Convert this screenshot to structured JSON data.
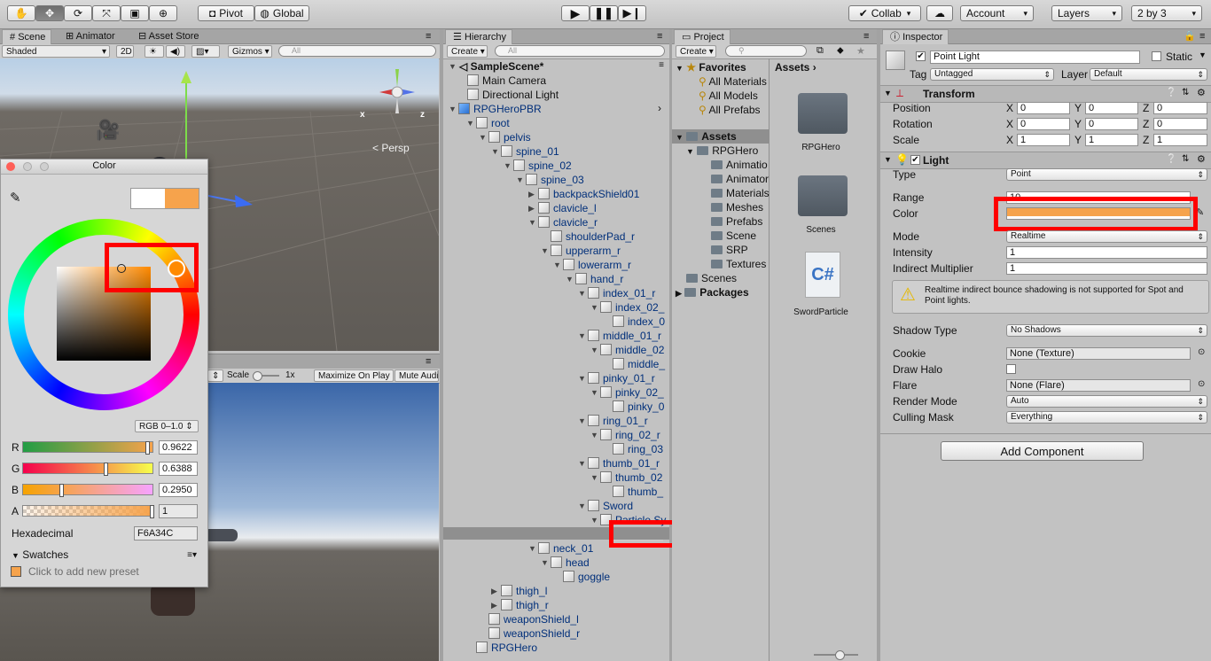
{
  "toolbar": {
    "tools": [
      "hand-tool",
      "move-tool",
      "rotate-tool",
      "scale-tool",
      "rect-tool",
      "transform-tool"
    ],
    "pivot": "Pivot",
    "global": "Global",
    "collab": "Collab",
    "account": "Account",
    "layers": "Layers",
    "layout": "2 by 3"
  },
  "scene": {
    "tabs": [
      "Scene",
      "Animator",
      "Asset Store"
    ],
    "shading": "Shaded",
    "mode2d": "2D",
    "gizmos": "Gizmos",
    "search_placeholder": "All",
    "persp": "Persp",
    "axis_x": "x",
    "axis_z": "z"
  },
  "game": {
    "scale_label": "Scale",
    "scale_value": "1x",
    "maximize": "Maximize On Play",
    "mute": "Mute Audi"
  },
  "color_picker": {
    "title": "Color",
    "mode": "RGB 0–1.0",
    "channels": [
      {
        "name": "R",
        "value": "0.9622",
        "level": 0.9622
      },
      {
        "name": "G",
        "value": "0.6388",
        "level": 0.6388
      },
      {
        "name": "B",
        "value": "0.2950",
        "level": 0.295
      },
      {
        "name": "A",
        "value": "1",
        "level": 1
      }
    ],
    "hex_label": "Hexadecimal",
    "hex_value": "F6A34C",
    "swatches_label": "Swatches",
    "swatch_hint": "Click to add new preset",
    "current_color": "#F6A34C",
    "previous_color": "#ffffff"
  },
  "hierarchy": {
    "title": "Hierarchy",
    "create": "Create",
    "search_placeholder": "All",
    "scene_name": "SampleScene*",
    "items": [
      {
        "label": "Main Camera"
      },
      {
        "label": "Directional Light"
      },
      {
        "label": "RPGHeroPBR"
      },
      {
        "label": "root"
      },
      {
        "label": "pelvis"
      },
      {
        "label": "spine_01"
      },
      {
        "label": "spine_02"
      },
      {
        "label": "spine_03"
      },
      {
        "label": "backpackShield01"
      },
      {
        "label": "clavicle_l"
      },
      {
        "label": "clavicle_r"
      },
      {
        "label": "shoulderPad_r"
      },
      {
        "label": "upperarm_r"
      },
      {
        "label": "lowerarm_r"
      },
      {
        "label": "hand_r"
      },
      {
        "label": "index_01_r"
      },
      {
        "label": "index_02_"
      },
      {
        "label": "index_0"
      },
      {
        "label": "middle_01_r"
      },
      {
        "label": "middle_02"
      },
      {
        "label": "middle_"
      },
      {
        "label": "pinky_01_r"
      },
      {
        "label": "pinky_02_"
      },
      {
        "label": "pinky_0"
      },
      {
        "label": "ring_01_r"
      },
      {
        "label": "ring_02_r"
      },
      {
        "label": "ring_03"
      },
      {
        "label": "thumb_01_r"
      },
      {
        "label": "thumb_02"
      },
      {
        "label": "thumb_"
      },
      {
        "label": "Sword"
      },
      {
        "label": "Particle Sy"
      },
      {
        "label": "Point Li"
      },
      {
        "label": "neck_01"
      },
      {
        "label": "head"
      },
      {
        "label": "goggle"
      },
      {
        "label": "thigh_l"
      },
      {
        "label": "thigh_r"
      },
      {
        "label": "weaponShield_l"
      },
      {
        "label": "weaponShield_r"
      },
      {
        "label": "RPGHero"
      }
    ]
  },
  "project": {
    "title": "Project",
    "create": "Create",
    "favorites": "Favorites",
    "favorite_items": [
      "All Materials",
      "All Models",
      "All Prefabs"
    ],
    "assets": "Assets",
    "tree": [
      "RPGHero",
      "Animatio",
      "Animator",
      "Materials",
      "Meshes",
      "Prefabs",
      "Scene",
      "SRP",
      "Textures",
      "Scenes"
    ],
    "packages": "Packages",
    "breadcrumb": "Assets",
    "grid": [
      "RPGHero",
      "Scenes",
      "SwordParticle"
    ],
    "script_glyph": "C#"
  },
  "inspector": {
    "title": "Inspector",
    "object_name": "Point Light",
    "static_label": "Static",
    "tag_label": "Tag",
    "tag_value": "Untagged",
    "layer_label": "Layer",
    "layer_value": "Default",
    "transform": {
      "title": "Transform",
      "rows": [
        {
          "label": "Position",
          "x": "0",
          "y": "0",
          "z": "0"
        },
        {
          "label": "Rotation",
          "x": "0",
          "y": "0",
          "z": "0"
        },
        {
          "label": "Scale",
          "x": "1",
          "y": "1",
          "z": "1"
        }
      ],
      "axis_x": "X",
      "axis_y": "Y",
      "axis_z": "Z"
    },
    "light": {
      "title": "Light",
      "type_label": "Type",
      "type_value": "Point",
      "range_label": "Range",
      "range_value": "10",
      "color_label": "Color",
      "color_value": "#F6A34C",
      "mode_label": "Mode",
      "mode_value": "Realtime",
      "intensity_label": "Intensity",
      "intensity_value": "1",
      "indirect_label": "Indirect Multiplier",
      "indirect_value": "1",
      "warning": "Realtime indirect bounce shadowing is not supported for Spot and Point lights.",
      "shadow_label": "Shadow Type",
      "shadow_value": "No Shadows",
      "cookie_label": "Cookie",
      "cookie_value": "None (Texture)",
      "halo_label": "Draw Halo",
      "flare_label": "Flare",
      "flare_value": "None (Flare)",
      "render_label": "Render Mode",
      "render_value": "Auto",
      "culling_label": "Culling Mask",
      "culling_value": "Everything"
    },
    "add_component": "Add Component"
  }
}
